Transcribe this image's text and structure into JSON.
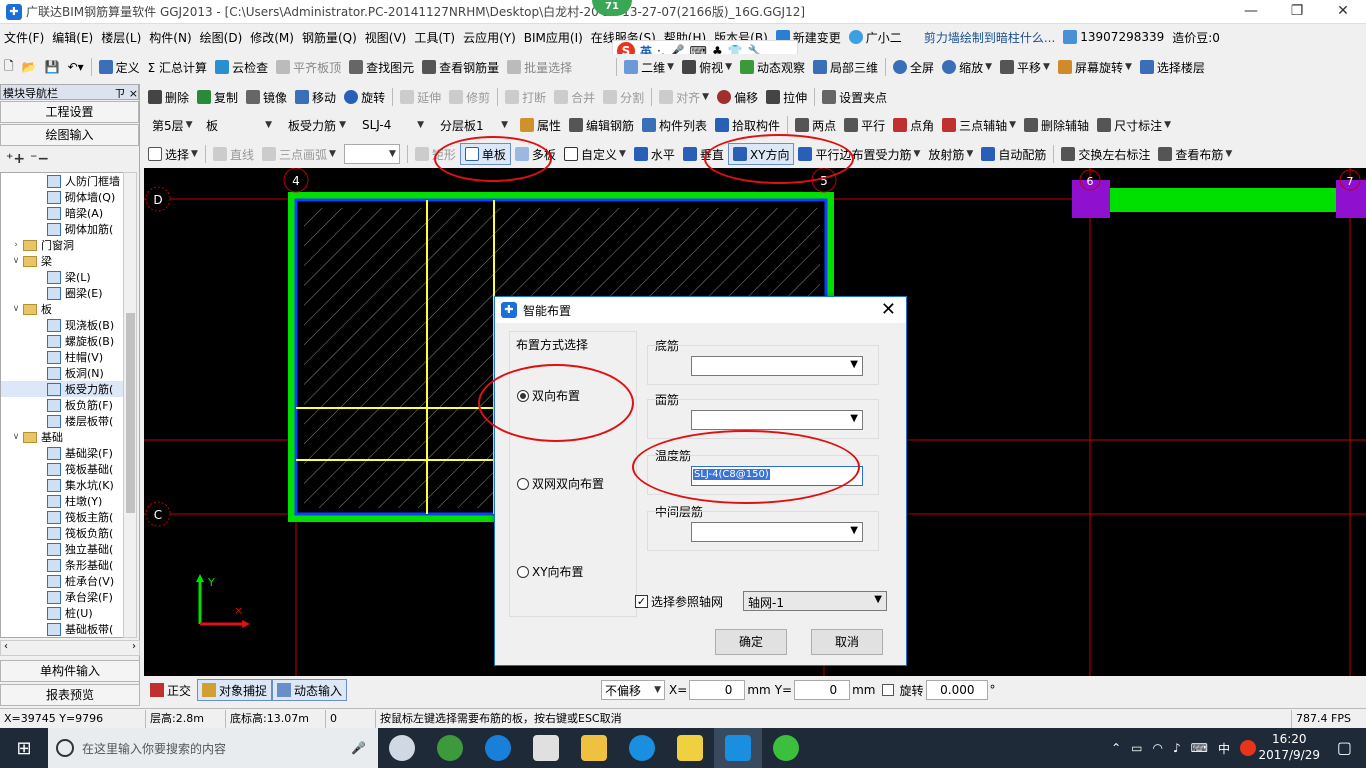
{
  "window": {
    "title": "广联达BIM钢筋算量软件 GGJ2013 - [C:\\Users\\Administrator.PC-20141127NRHM\\Desktop\\白龙村-20          25-13-27-07(2166版)_16G.GGJ12]",
    "badge": "71"
  },
  "menu": [
    "文件(F)",
    "编辑(E)",
    "楼层(L)",
    "构件(N)",
    "绘图(D)",
    "修改(M)",
    "钢筋量(Q)",
    "视图(V)",
    "工具(T)",
    "云应用(Y)",
    "BIM应用(I)",
    "在线服务(S)",
    "帮助(H)",
    "版本号(B)"
  ],
  "menu_right": {
    "new_change": "新建变更",
    "assistant": "广小二",
    "hint": "剪力墙绘制到暗柱什么...",
    "phone": "13907298339",
    "cost_bean": "造价豆:0"
  },
  "ime_label": "英",
  "toolbar1": [
    "定义",
    "Σ 汇总计算",
    "云检查",
    "平齐板顶",
    "查找图元",
    "查看钢筋量",
    "批量选择",
    "二维",
    "俯视",
    "动态观察",
    "局部三维",
    "全屏",
    "缩放",
    "平移",
    "屏幕旋转",
    "选择楼层"
  ],
  "toolbar2": [
    "删除",
    "复制",
    "镜像",
    "移动",
    "旋转",
    "延伸",
    "修剪",
    "打断",
    "合并",
    "分割",
    "对齐",
    "偏移",
    "拉伸",
    "设置夹点"
  ],
  "toolbar3": {
    "floor": "第5层",
    "type": "板",
    "sub": "板受力筋",
    "code": "SLJ-4",
    "layer": "分层板1",
    "items": [
      "属性",
      "编辑钢筋",
      "构件列表",
      "拾取构件",
      "两点",
      "平行",
      "点角",
      "三点辅轴",
      "删除辅轴",
      "尺寸标注"
    ]
  },
  "toolbar4": {
    "select": "选择",
    "line": "直线",
    "arc": "三点画弧",
    "rect": "矩形",
    "single": "单板",
    "multi": "多板",
    "custom": "自定义",
    "horizontal": "水平",
    "vertical": "垂直",
    "xy": "XY方向",
    "parallel": "平行边布置受力筋",
    "radial": "放射筋",
    "auto": "自动配筋",
    "swap": "交换左右标注",
    "view": "查看布筋"
  },
  "nav": {
    "title": "模块导航栏",
    "pin": "ㄗ ×",
    "btn_project": "工程设置",
    "btn_draw": "绘图输入",
    "btn_single": "单构件输入",
    "btn_report": "报表预览",
    "tree": [
      {
        "label": "人防门框墙",
        "level": 2,
        "kind": "item"
      },
      {
        "label": "砌体墙(Q)",
        "level": 2,
        "kind": "item"
      },
      {
        "label": "暗梁(A)",
        "level": 2,
        "kind": "item"
      },
      {
        "label": "砌体加筋(",
        "level": 2,
        "kind": "item"
      },
      {
        "label": "门窗洞",
        "level": 1,
        "kind": "folder",
        "toggle": "›"
      },
      {
        "label": "梁",
        "level": 1,
        "kind": "folder",
        "toggle": "∨"
      },
      {
        "label": "梁(L)",
        "level": 2,
        "kind": "item"
      },
      {
        "label": "圈梁(E)",
        "level": 2,
        "kind": "item"
      },
      {
        "label": "板",
        "level": 1,
        "kind": "folder",
        "toggle": "∨"
      },
      {
        "label": "现浇板(B)",
        "level": 2,
        "kind": "item"
      },
      {
        "label": "螺旋板(B)",
        "level": 2,
        "kind": "item"
      },
      {
        "label": "柱帽(V)",
        "level": 2,
        "kind": "item"
      },
      {
        "label": "板洞(N)",
        "level": 2,
        "kind": "item"
      },
      {
        "label": "板受力筋(",
        "level": 2,
        "kind": "item",
        "selected": true
      },
      {
        "label": "板负筋(F)",
        "level": 2,
        "kind": "item"
      },
      {
        "label": "楼层板带(",
        "level": 2,
        "kind": "item"
      },
      {
        "label": "基础",
        "level": 1,
        "kind": "folder",
        "toggle": "∨"
      },
      {
        "label": "基础梁(F)",
        "level": 2,
        "kind": "item"
      },
      {
        "label": "筏板基础(",
        "level": 2,
        "kind": "item"
      },
      {
        "label": "集水坑(K)",
        "level": 2,
        "kind": "item"
      },
      {
        "label": "柱墩(Y)",
        "level": 2,
        "kind": "item"
      },
      {
        "label": "筏板主筋(",
        "level": 2,
        "kind": "item"
      },
      {
        "label": "筏板负筋(",
        "level": 2,
        "kind": "item"
      },
      {
        "label": "独立基础(",
        "level": 2,
        "kind": "item"
      },
      {
        "label": "条形基础(",
        "level": 2,
        "kind": "item"
      },
      {
        "label": "桩承台(V)",
        "level": 2,
        "kind": "item"
      },
      {
        "label": "承台梁(F)",
        "level": 2,
        "kind": "item"
      },
      {
        "label": "桩(U)",
        "level": 2,
        "kind": "item"
      },
      {
        "label": "基础板带(",
        "level": 2,
        "kind": "item"
      }
    ]
  },
  "canvas": {
    "axis_labels": {
      "a4": "4",
      "a5": "5",
      "a6": "6",
      "a7": "7",
      "d": "D",
      "c": "C"
    },
    "ucs": {
      "y": "Y"
    }
  },
  "dialog": {
    "title": "智能布置",
    "group_title": "布置方式选择",
    "options": [
      "双向布置",
      "双网双向布置",
      "XY向布置"
    ],
    "selected": 0,
    "bottom_label": "底筋",
    "top_label": "面筋",
    "temp_label": "温度筋",
    "temp_value": "SLJ-4(C8@150)",
    "mid_label": "中间层筋",
    "ref_axis_label": "选择参照轴网",
    "ref_axis_value": "轴网-1",
    "ok": "确定",
    "cancel": "取消"
  },
  "status1": {
    "ortho": "正交",
    "snap": "对象捕捉",
    "dynamic": "动态输入",
    "offset": "不偏移",
    "x_label": "X=",
    "x_value": "0",
    "x_unit": "mm",
    "y_label": "Y=",
    "y_value": "0",
    "y_unit": "mm",
    "rotate": "旋转",
    "rotate_value": "0.000",
    "deg": "°"
  },
  "status2": {
    "coords": "X=39745 Y=9796",
    "floor_h": "层高:2.8m",
    "base_h": "底标高:13.07m",
    "zero": "0",
    "hint": "按鼠标左键选择需要布筋的板，按右键或ESC取消",
    "fps": "787.4 FPS"
  },
  "taskbar": {
    "search": "在这里输入你要搜索的内容",
    "time": "16:20",
    "date": "2017/9/29",
    "lang": "中"
  },
  "colors": {
    "slab_green": "#00e000",
    "beam_blue": "#1040ff",
    "grid_red": "#c00000",
    "rebar_yellow": "#ffff40",
    "column_purple": "#9010d0",
    "highlight_red": "#e01010"
  }
}
